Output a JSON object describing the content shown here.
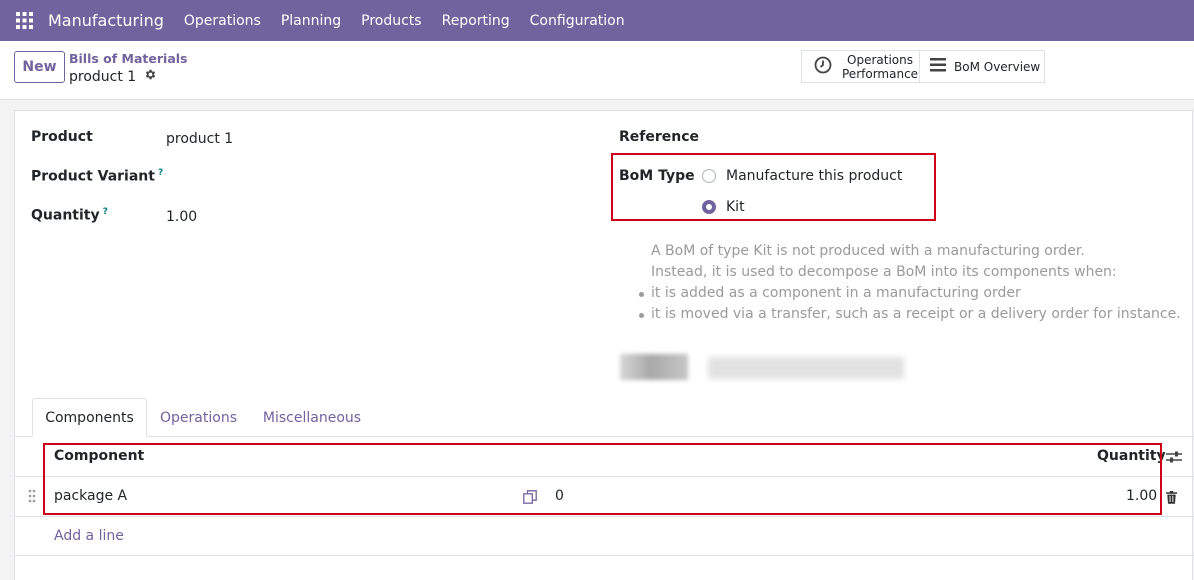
{
  "navbar": {
    "app_name": "Manufacturing",
    "menu": [
      "Operations",
      "Planning",
      "Products",
      "Reporting",
      "Configuration"
    ],
    "apps_icon": "grid-icon"
  },
  "control_panel": {
    "new_label": "New",
    "breadcrumb": "Bills of Materials",
    "record_title": "product 1",
    "smart_buttons": {
      "operations_performance": [
        "Operations",
        "Performance"
      ],
      "bom_overview": "BoM Overview"
    }
  },
  "form": {
    "product_label": "Product",
    "product_value": "product 1",
    "variant_label": "Product Variant",
    "variant_help": "?",
    "quantity_label": "Quantity",
    "quantity_help": "?",
    "quantity_value": "1.00",
    "reference_label": "Reference",
    "bom_type_label": "BoM Type",
    "bom_type_options": [
      "Manufacture this product",
      "Kit"
    ],
    "bom_type_selected": "Kit",
    "kit_help": {
      "line1": "A BoM of type Kit is not produced with a manufacturing order.",
      "line2": "Instead, it is used to decompose a BoM into its components when:",
      "bullets": [
        "it is added as a component in a manufacturing order",
        "it is moved via a transfer, such as a receipt or a delivery order for instance."
      ]
    }
  },
  "tabs": [
    "Components",
    "Operations",
    "Miscellaneous"
  ],
  "active_tab": "Components",
  "components_table": {
    "headers": {
      "component": "Component",
      "quantity": "Quantity"
    },
    "rows": [
      {
        "component": "package A",
        "count": "0",
        "quantity": "1.00"
      }
    ],
    "add_line": "Add a line"
  },
  "colors": {
    "brand": "#71639e",
    "highlight": "#d0021b",
    "help_text": "#9a9a9a",
    "help_mark": "#017e84"
  }
}
